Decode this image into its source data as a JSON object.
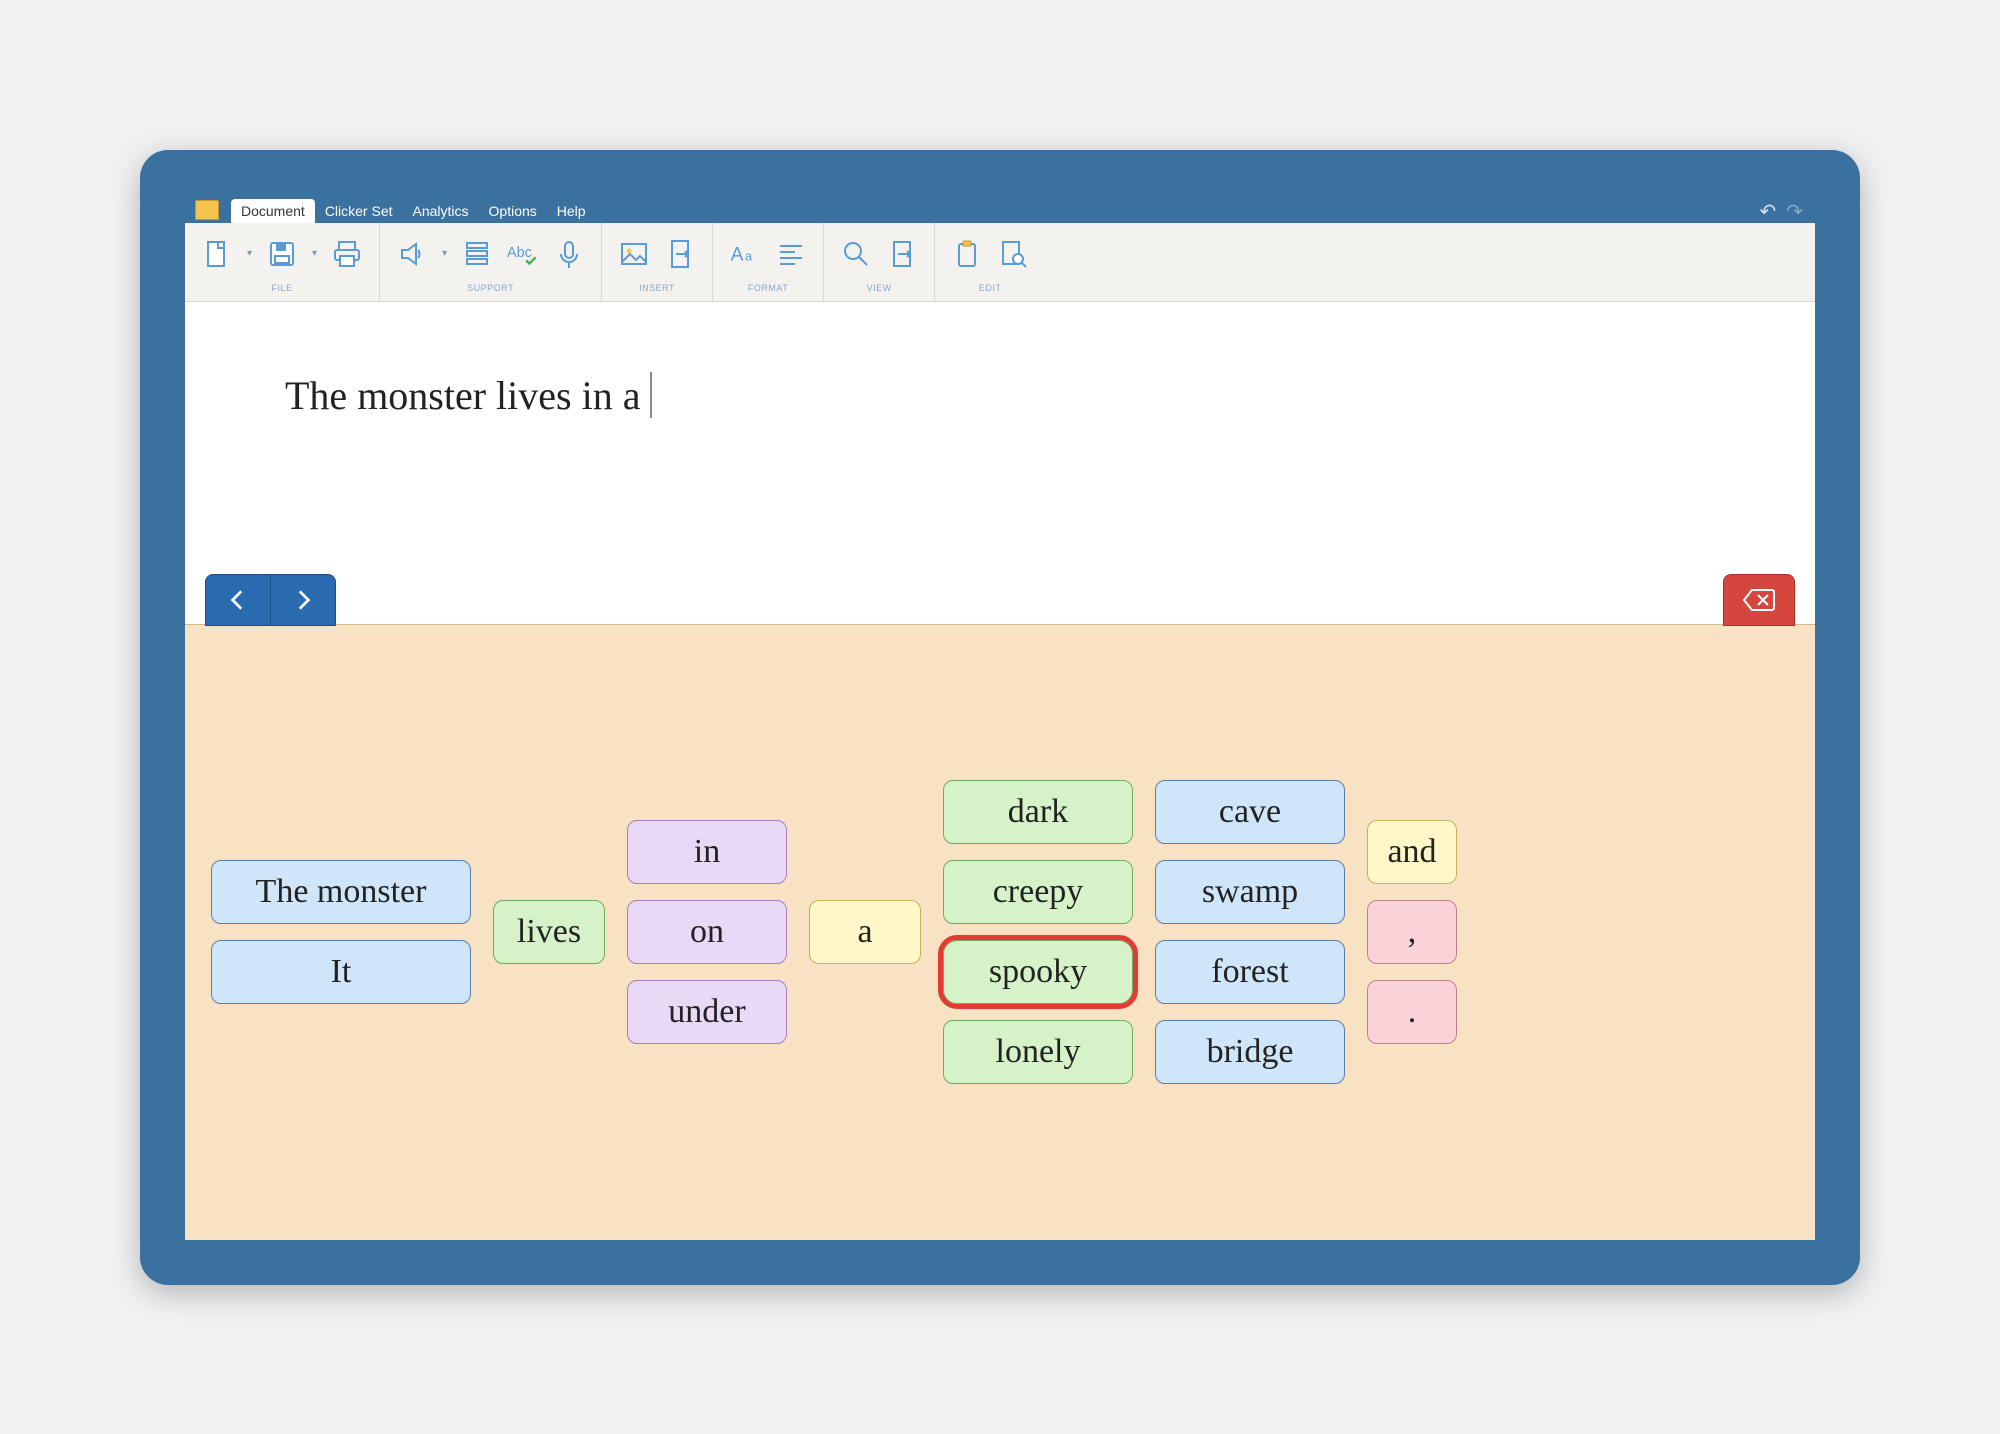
{
  "menu": {
    "tabs": [
      "Document",
      "Clicker Set",
      "Analytics",
      "Options",
      "Help"
    ],
    "active": 0
  },
  "toolbar": {
    "groups": [
      {
        "label": "FILE"
      },
      {
        "label": "SUPPORT"
      },
      {
        "label": "INSERT"
      },
      {
        "label": "FORMAT"
      },
      {
        "label": "VIEW"
      },
      {
        "label": "EDIT"
      }
    ]
  },
  "document": {
    "text": "The monster lives in a"
  },
  "grid": {
    "cols": [
      {
        "cls": "c-blue",
        "w": "w-subject",
        "cells": [
          {
            "t": "The monster"
          },
          {
            "t": "It"
          }
        ]
      },
      {
        "cls": "c-green",
        "w": "w-small",
        "cells": [
          {
            "t": "lives"
          }
        ]
      },
      {
        "cls": "c-purple",
        "w": "w-med",
        "cells": [
          {
            "t": "in"
          },
          {
            "t": "on"
          },
          {
            "t": "under"
          }
        ]
      },
      {
        "cls": "c-yellow",
        "w": "w-small",
        "cells": [
          {
            "t": "a"
          }
        ]
      },
      {
        "cls": "c-green",
        "w": "w-adj",
        "cells": [
          {
            "t": "dark"
          },
          {
            "t": "creepy"
          },
          {
            "t": "spooky",
            "sel": true
          },
          {
            "t": "lonely"
          }
        ]
      },
      {
        "cls": "c-blue",
        "w": "w-noun",
        "cells": [
          {
            "t": "cave"
          },
          {
            "t": "swamp"
          },
          {
            "t": "forest"
          },
          {
            "t": "bridge"
          }
        ]
      },
      {
        "mixed": true,
        "w": "w-punct",
        "cells": [
          {
            "t": "and",
            "cls": "c-yellow"
          },
          {
            "t": ",",
            "cls": "c-pink"
          },
          {
            "t": ".",
            "cls": "c-pink"
          }
        ]
      }
    ]
  }
}
